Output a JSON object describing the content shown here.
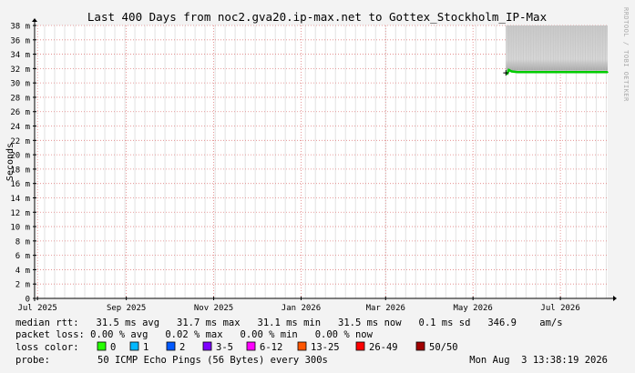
{
  "chart_data": {
    "type": "area",
    "title": "Last 400 Days from noc2.gva20.ip-max.net to Gottex_Stockholm_IP-Max",
    "ylabel": "Seconds",
    "watermark": "RRDTOOL / TOBI OETIKER",
    "ylim": [
      0,
      38
    ],
    "y_ticks": [
      "0",
      "2 m",
      "4 m",
      "6 m",
      "8 m",
      "10 m",
      "12 m",
      "14 m",
      "16 m",
      "18 m",
      "20 m",
      "22 m",
      "24 m",
      "26 m",
      "28 m",
      "30 m",
      "32 m",
      "34 m",
      "36 m",
      "38 m"
    ],
    "y_tick_values": [
      0,
      2,
      4,
      6,
      8,
      10,
      12,
      14,
      16,
      18,
      20,
      22,
      24,
      26,
      28,
      30,
      32,
      34,
      36,
      38
    ],
    "x_ticks": [
      "Jul 2025",
      "Sep 2025",
      "Nov 2025",
      "Jan 2026",
      "Mar 2026",
      "May 2026",
      "Jul 2026"
    ],
    "x_tick_dates": [
      "2025-07-01",
      "2025-09-01",
      "2025-11-01",
      "2026-01-01",
      "2026-03-01",
      "2026-05-01",
      "2026-07-01"
    ],
    "xlim": [
      "2025-06-29",
      "2026-08-03"
    ],
    "grid": true,
    "series": [
      {
        "name": "median rtt",
        "color": "#00cc00",
        "x": [
          "2026-05-24",
          "2026-05-25",
          "2026-05-26",
          "2026-05-28",
          "2026-06-01",
          "2026-06-15",
          "2026-07-01",
          "2026-07-15",
          "2026-08-03"
        ],
        "values": [
          31.4,
          31.3,
          31.8,
          31.6,
          31.5,
          31.5,
          31.5,
          31.5,
          31.5
        ]
      }
    ],
    "smoke": {
      "x_start": "2026-05-24",
      "x_end": "2026-08-03",
      "lower": 31.7,
      "upper": 38
    }
  },
  "stats": {
    "median_rtt": "median rtt:   31.5 ms avg   31.7 ms max   31.1 ms min   31.5 ms now   0.1 ms sd   346.9    am/s",
    "packet_loss": "packet loss: 0.00 % avg   0.02 % max   0.00 % min   0.00 % now"
  },
  "loss_color": {
    "label": "loss color:",
    "items": [
      {
        "label": "0",
        "color": "#26ff00"
      },
      {
        "label": "1",
        "color": "#00b8ff"
      },
      {
        "label": "2",
        "color": "#0059ff"
      },
      {
        "label": "3-5",
        "color": "#7e00ff"
      },
      {
        "label": "6-12",
        "color": "#ff00ff"
      },
      {
        "label": "13-25",
        "color": "#ff5500"
      },
      {
        "label": "26-49",
        "color": "#ff0000"
      },
      {
        "label": "50/50",
        "color": "#a10000"
      }
    ]
  },
  "probe": {
    "label": "probe:",
    "text": "50 ICMP Echo Pings (56 Bytes) every 300s",
    "timestamp": "Mon Aug  3 13:38:19 2026"
  }
}
